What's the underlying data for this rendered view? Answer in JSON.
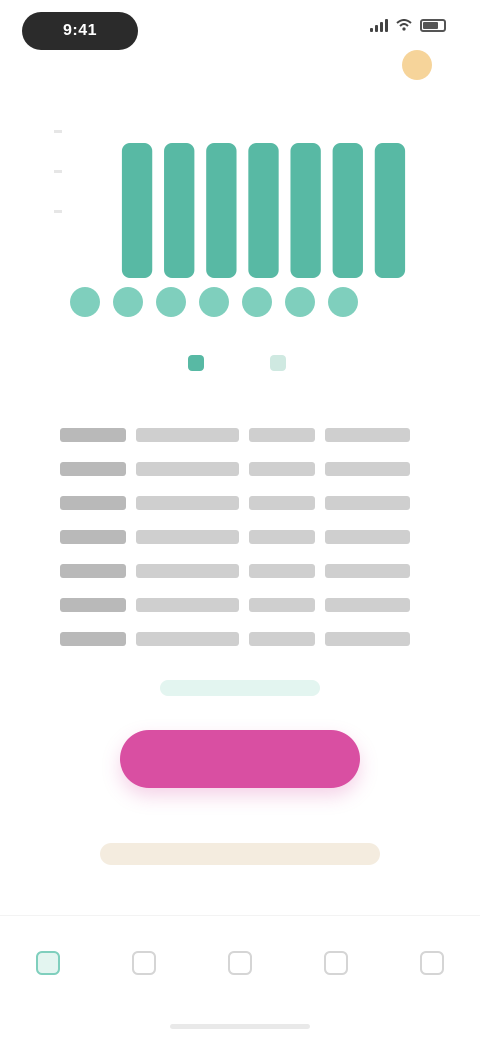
{
  "status_bar": {
    "time": "9:41"
  },
  "colors": {
    "accent_teal": "#58b9a4",
    "light_teal": "#7fcfbd",
    "primary_pink": "#d94fa2",
    "footnote_beige": "#f4ecdf"
  },
  "chart_data": {
    "type": "bar",
    "categories": [
      "",
      "",
      "",
      "",
      "",
      "",
      ""
    ],
    "values": [
      9,
      9,
      9,
      9,
      9,
      9,
      9
    ],
    "ylim": [
      0,
      10
    ],
    "grid": false,
    "legend": "bottom"
  },
  "dots": [
    1,
    1,
    1,
    1,
    1,
    1,
    1
  ],
  "legend": {
    "items": [
      {
        "label": "",
        "swatch": "dark"
      },
      {
        "label": "",
        "swatch": "light"
      }
    ]
  },
  "table": {
    "rows": [
      [
        "",
        "",
        "",
        ""
      ],
      [
        "",
        "",
        "",
        ""
      ],
      [
        "",
        "",
        "",
        ""
      ],
      [
        "",
        "",
        "",
        ""
      ],
      [
        "",
        "",
        "",
        ""
      ],
      [
        "",
        "",
        "",
        ""
      ],
      [
        "",
        "",
        "",
        ""
      ]
    ]
  },
  "sub_link": {
    "label": ""
  },
  "primary_button": {
    "label": ""
  },
  "footnote": {
    "text": ""
  },
  "bottom_nav": {
    "items": [
      {
        "label": "",
        "icon": "home-icon",
        "active": true
      },
      {
        "label": "",
        "icon": "chart-icon",
        "active": false
      },
      {
        "label": "",
        "icon": "calendar-icon",
        "active": false
      },
      {
        "label": "",
        "icon": "bell-icon",
        "active": false
      },
      {
        "label": "",
        "icon": "profile-icon",
        "active": false
      }
    ]
  }
}
